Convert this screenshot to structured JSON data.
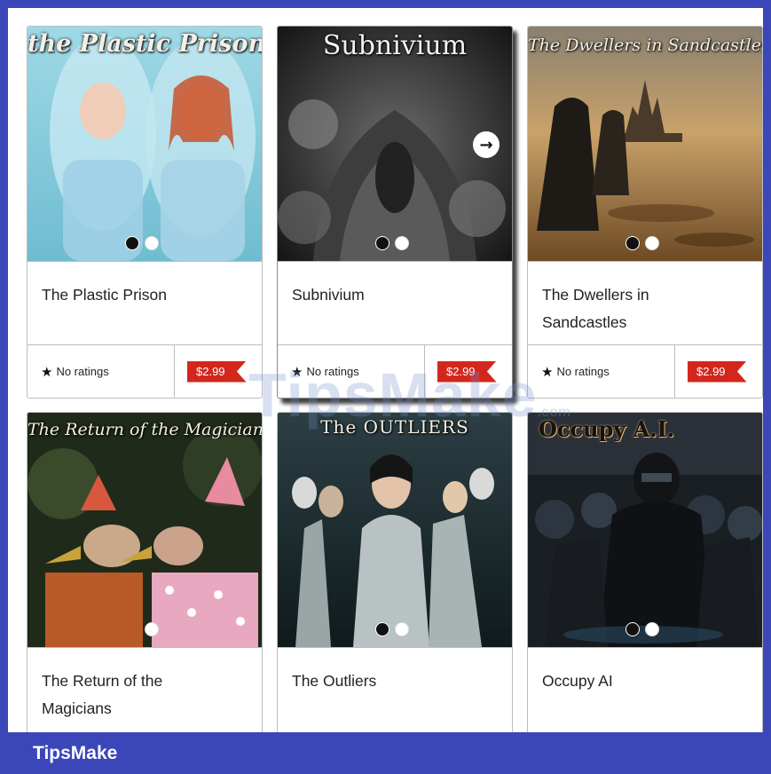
{
  "watermark": {
    "main": "TipsMake",
    "suffix": ".com"
  },
  "brand": {
    "label": "TipsMake",
    "color": "#3b46b8"
  },
  "books": [
    {
      "cover_title": "the Plastic Prison",
      "name": "The Plastic Prison",
      "rating": "No ratings",
      "price": "$2.99",
      "dots": [
        true,
        false
      ]
    },
    {
      "cover_title": "Subnivium",
      "name": "Subnivium",
      "rating": "No ratings",
      "price": "$2.99",
      "dots": [
        true,
        false
      ],
      "next_icon": "→"
    },
    {
      "cover_title": "The Dwellers in Sandcastles",
      "name_line1": "The Dwellers in",
      "name_line2": "Sandcastles",
      "rating": "No ratings",
      "price": "$2.99",
      "dots": [
        true,
        false
      ]
    },
    {
      "cover_title": "The Return of the Magicians",
      "name_line1": "The Return of the",
      "name_line2": "Magicians",
      "dots": [
        false
      ]
    },
    {
      "cover_title": "The OUTLIERS",
      "name": "The Outliers",
      "dots": [
        true,
        false
      ]
    },
    {
      "cover_title": "Occupy A.I.",
      "name": "Occupy AI",
      "dots": [
        true,
        false
      ]
    }
  ],
  "icons": {
    "star": "★",
    "rating_star_name": "star-icon",
    "next_name": "arrow-right-icon"
  }
}
